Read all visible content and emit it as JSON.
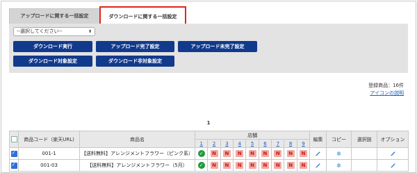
{
  "tabs": {
    "upload": "アップロードに関する一括設定",
    "download": "ダウンロードに関する一括設定"
  },
  "select": {
    "value": "--選択してください--"
  },
  "buttons": {
    "row1": [
      "ダウンロード実行",
      "アップロード完了設定",
      "アップロード未完了設定"
    ],
    "row2": [
      "ダウンロード対象設定",
      "ダウンロード非対象設定"
    ]
  },
  "meta": {
    "count": "登録商品：16件",
    "icon_help": "アイコンの説明"
  },
  "pager": {
    "page": "1"
  },
  "table": {
    "headers": {
      "code": "商品コード（楽天URL)",
      "name": "商品名",
      "stores": "店舗",
      "edit": "編集",
      "copy": "コピー",
      "choice": "選択肢",
      "option": "オプション"
    },
    "store_numbers": [
      "1",
      "2",
      "3",
      "4",
      "5",
      "6",
      "7",
      "8",
      "9"
    ],
    "rows": [
      {
        "code": "001-1",
        "name": "【送料無料】アレンジメントフラワー（ピンク系）",
        "store_marks": [
          "✓",
          "N",
          "N",
          "N",
          "N",
          "N",
          "N",
          "N",
          "N"
        ]
      },
      {
        "code": "001-03",
        "name": "【送料無料】アレンジメントフラワー（5月）",
        "store_marks": [
          "✓",
          "N",
          "N",
          "N",
          "N",
          "N",
          "N",
          "N",
          "N"
        ]
      }
    ]
  },
  "colors": {
    "button_bg": "#123a8c",
    "highlight_border": "#e0261c",
    "ok_green": "#1f9a3a",
    "n_red": "#c21d14",
    "link": "#1a5db8"
  }
}
